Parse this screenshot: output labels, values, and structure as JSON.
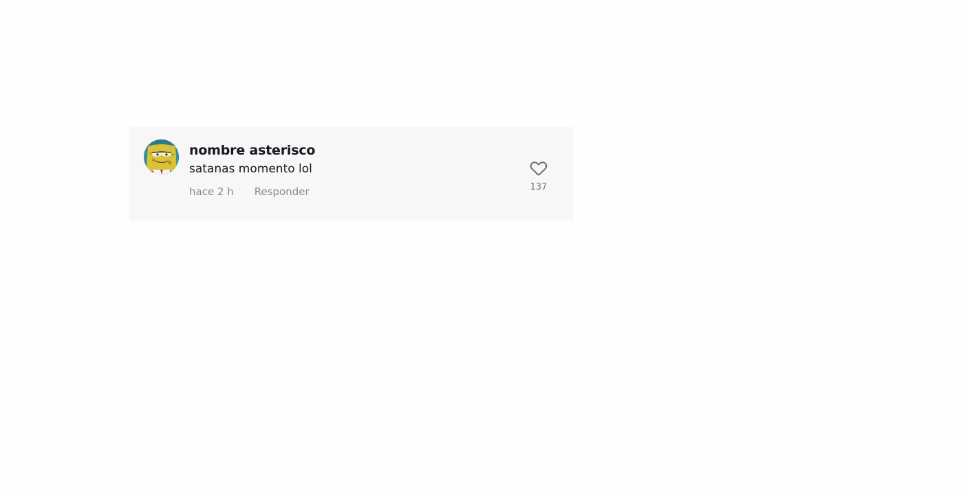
{
  "comment": {
    "username": "nombre asterisco",
    "text": "satanas momento lol",
    "time": "hace 2 h",
    "reply_label": "Responder",
    "like_count": "137",
    "avatar_icon": "spongebob-avatar",
    "like_icon": "heart-outline-icon"
  }
}
